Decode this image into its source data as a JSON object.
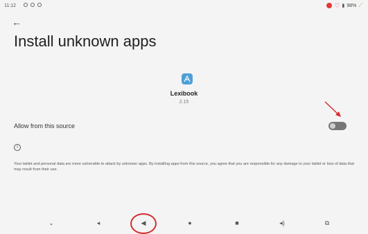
{
  "status_bar": {
    "time": "11:12",
    "battery": "98%",
    "icons": [
      "settings-dot-icon",
      "settings-dot-icon",
      "settings-dot-icon",
      "notification-badge-icon",
      "heart-icon",
      "battery-icon",
      "signal-icon"
    ]
  },
  "header": {
    "title": "Install unknown apps"
  },
  "app": {
    "name": "Lexibook",
    "version": "2.15"
  },
  "setting": {
    "label": "Allow from this source",
    "toggle_on": false
  },
  "info": {
    "warning": "Your tablet and personal data are more vulnerable to attack by unknown apps. By installing apps from this source, you agree that you are responsible for any damage to your tablet or loss of data that may result from their use."
  },
  "nav_bar": {
    "buttons": [
      "chevron-down-icon",
      "volume-down-icon",
      "back-icon",
      "home-icon",
      "recents-icon",
      "volume-up-icon",
      "screenshot-icon"
    ]
  },
  "colors": {
    "annotation": "#d32f2f",
    "toggle_off": "#777777",
    "app_icon": "#4f9fd6"
  }
}
